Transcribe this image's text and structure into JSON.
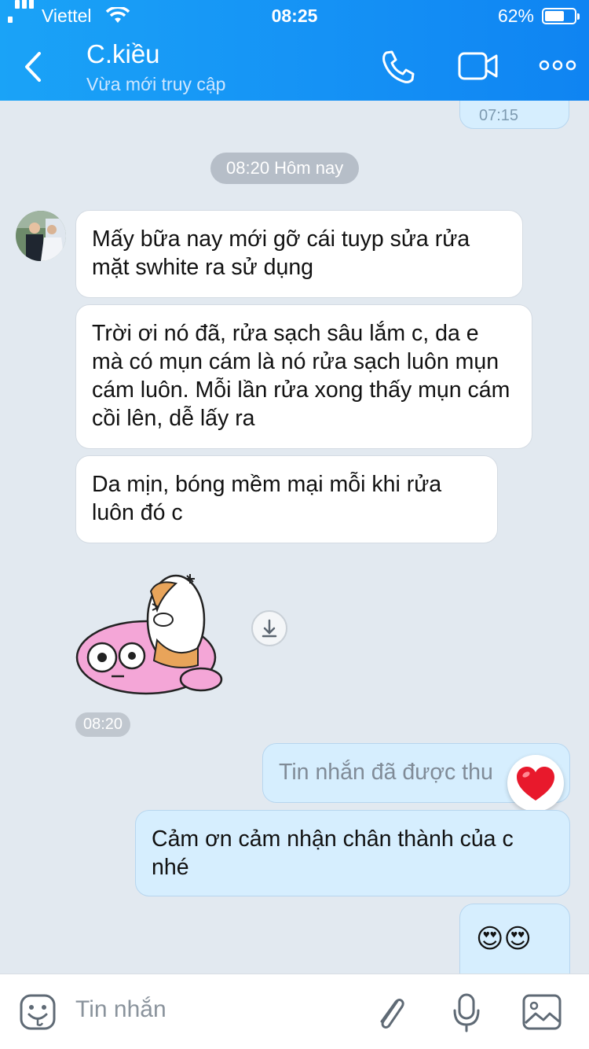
{
  "status_bar": {
    "carrier": "Viettel",
    "time": "08:25",
    "battery": "62%"
  },
  "header": {
    "contact_name": "C.kiều",
    "contact_status": "Vừa mới truy cập"
  },
  "messages": {
    "prev_time": "07:15",
    "date_divider": "08:20 Hôm nay",
    "incoming": [
      "Mấy bữa nay mới gỡ cái tuyp sửa rửa mặt swhite ra sử dụng",
      "Trời ơi nó đã, rửa sạch sâu lắm c, da e mà có mụn cám là nó rửa sạch luôn mụn cám luôn. Mỗi lần rửa xong thấy mụn cám cồi lên, dễ lấy ra",
      "Da mịn, bóng mềm mại mỗi khi rửa luôn đó c"
    ],
    "sticker_time": "08:20",
    "recalled": "Tin nhắn đã được thu",
    "reply": "Cảm ơn cảm nhận chân thành của c nhé",
    "last_emoji": "😍😍"
  },
  "input": {
    "placeholder": "Tin nhắn"
  },
  "icons": {
    "back": "back-arrow-icon",
    "call": "phone-icon",
    "video": "video-camera-icon",
    "more": "more-dots-icon",
    "emoji": "sticker-face-icon",
    "attach": "paperclip-icon",
    "mic": "microphone-icon",
    "image": "image-icon",
    "download": "download-icon",
    "reaction": "heart-icon"
  },
  "colors": {
    "header": "#1592f5",
    "chat_bg": "#e2e9f0",
    "my_bubble": "#d6eefe",
    "reaction_heart": "#e8192c"
  }
}
